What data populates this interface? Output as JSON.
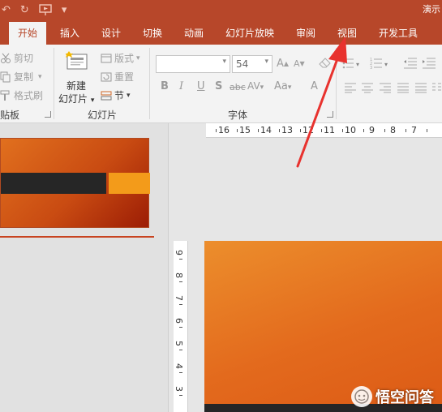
{
  "app": {
    "title_fragment": "演示",
    "accent_color": "#b7472a"
  },
  "tabs": [
    {
      "label": "开始",
      "active": true
    },
    {
      "label": "插入"
    },
    {
      "label": "设计"
    },
    {
      "label": "切换"
    },
    {
      "label": "动画"
    },
    {
      "label": "幻灯片放映"
    },
    {
      "label": "审阅"
    },
    {
      "label": "视图"
    },
    {
      "label": "开发工具"
    }
  ],
  "ribbon": {
    "clipboard": {
      "cut": "剪切",
      "copy": "复制",
      "format_painter": "格式刷",
      "label": "贴板"
    },
    "slides": {
      "new_slide_line1": "新建",
      "new_slide_line2": "幻灯片",
      "layout": "版式",
      "reset": "重置",
      "section": "节",
      "label": "幻灯片"
    },
    "font": {
      "font_name": "",
      "font_size": "54",
      "label": "字体",
      "grow": "A",
      "shrink": "A",
      "bold": "B",
      "italic": "I",
      "underline": "U",
      "shadow": "S",
      "strike": "abc",
      "spacing": "AV",
      "case": "Aa",
      "color": "A"
    }
  },
  "ruler": {
    "horizontal": [
      "16",
      "15",
      "14",
      "13",
      "12",
      "11",
      "10",
      "9",
      "8",
      "7"
    ],
    "vertical": [
      "9",
      "8",
      "7",
      "6",
      "5",
      "4",
      "3"
    ]
  },
  "watermark": {
    "text": "悟空问答"
  }
}
